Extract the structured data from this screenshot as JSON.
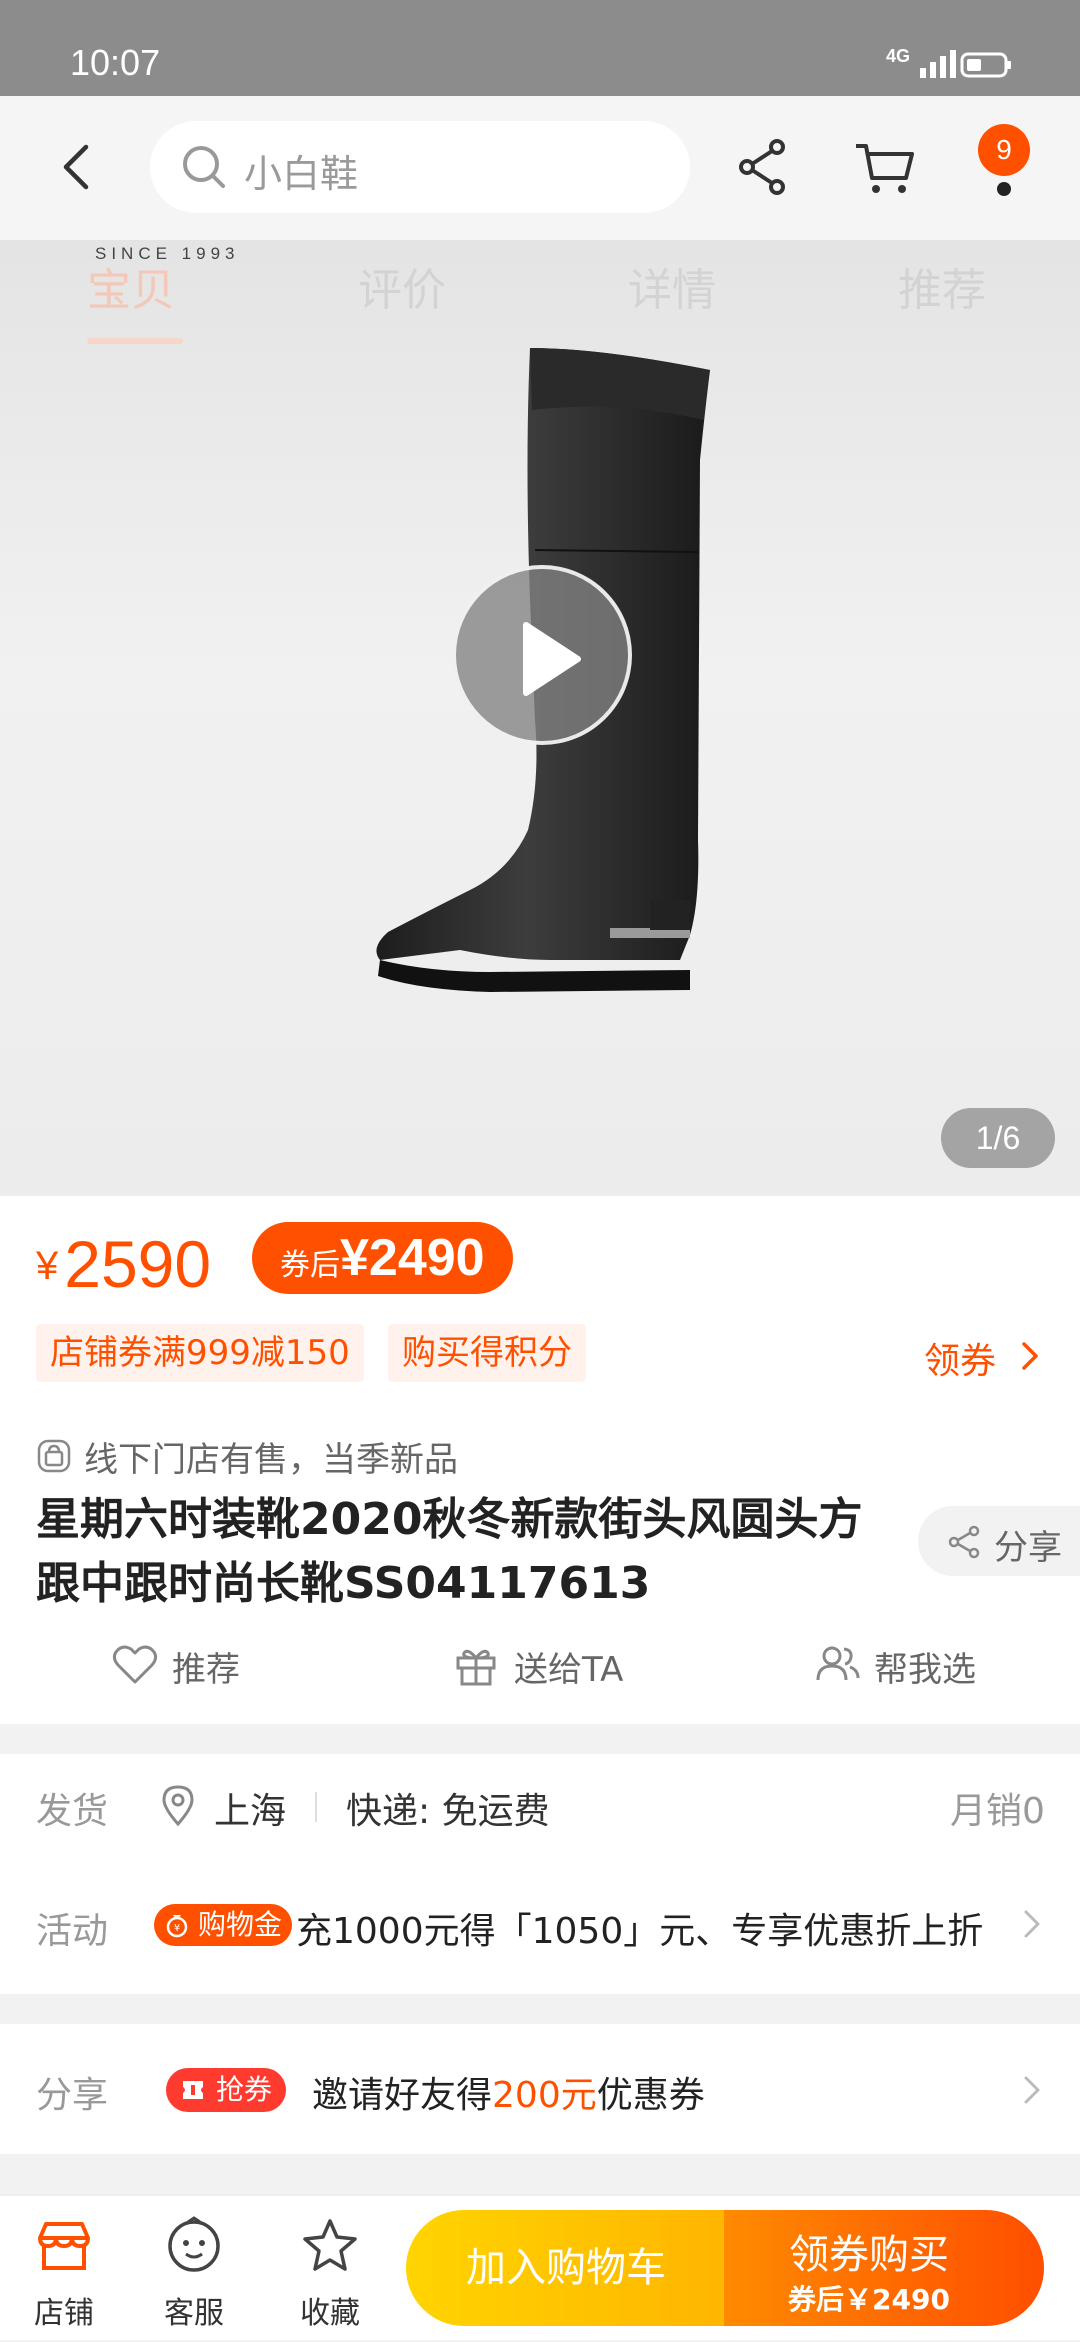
{
  "status_bar": {
    "time": "10:07",
    "network": "4G"
  },
  "top_bar": {
    "search_placeholder": "小白鞋",
    "cart_badge": "9"
  },
  "hero": {
    "brand_text": "SINCE 1993",
    "tabs": [
      {
        "label": "宝贝",
        "active": true
      },
      {
        "label": "评价",
        "active": false
      },
      {
        "label": "详情",
        "active": false
      },
      {
        "label": "推荐",
        "active": false
      }
    ],
    "image_counter": "1/6"
  },
  "product": {
    "currency": "¥",
    "price": "2590",
    "coupon_price_label": "券后",
    "coupon_price": "¥2490",
    "tags": [
      "店铺券满999减150",
      "购买得积分"
    ],
    "get_coupon_label": "领券",
    "offline_note": "线下门店有售，当季新品",
    "title": "星期六时装靴2020秋冬新款街头风圆头方跟中跟时尚长靴SS04117613",
    "share_label": "分享",
    "actions": [
      "推荐",
      "送给TA",
      "帮我选"
    ]
  },
  "shipping": {
    "label": "发货",
    "city": "上海",
    "express": "快递: 免运费",
    "monthly_sales": "月销0"
  },
  "activity": {
    "label": "活动",
    "badge": "购物金",
    "text": "充1000元得「1050」元、专享优惠折上折"
  },
  "share_section": {
    "label": "分享",
    "badge": "抢券",
    "text_before": "邀请好友得",
    "amount": "200元",
    "text_after": "优惠券"
  },
  "bottom_bar": {
    "items": [
      "店铺",
      "客服",
      "收藏"
    ],
    "add_to_cart": "加入购物车",
    "buy_label": "领券购买",
    "buy_sub": "券后￥2490"
  },
  "colors": {
    "accent": "#ff5000",
    "cart_button": "#ffc300",
    "status_bar": "#8c8c8c"
  }
}
